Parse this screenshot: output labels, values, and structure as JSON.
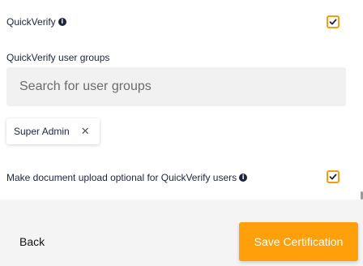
{
  "quickverify": {
    "label": "QuickVerify",
    "info_icon": "info-icon",
    "checked": true
  },
  "user_groups": {
    "label": "QuickVerify user groups",
    "search_placeholder": "Search for user groups",
    "selected": [
      {
        "label": "Super Admin",
        "remove_glyph": "✕"
      }
    ]
  },
  "optional_upload": {
    "label": "Make document upload optional for QuickVerify users",
    "info_icon": "info-icon",
    "checked": true
  },
  "footer": {
    "back_label": "Back",
    "save_label": "Save Certification"
  },
  "colors": {
    "accent": "#ff9f0a",
    "checkbox_border": "#f59e0b",
    "text": "#1c2540",
    "footer_bg": "#f4f4f4"
  }
}
